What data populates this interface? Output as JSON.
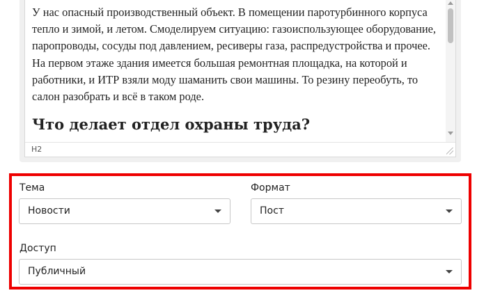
{
  "editor": {
    "paragraph": "У нас опасный производственный объект. В помещении паротурбинного корпуса тепло и зимой, и летом. Смоделируем ситуацию: газоиспользующее оборудование, паропроводы, сосуды под давлением, ресиверы газа, распредустройства и прочее. На первом этаже здания имеется большая ремонтная площадка, на которой и работники, и ИТР взяли моду шаманить свои машины. То резину переобуть, то салон разобрать и всё в таком роде.",
    "heading": "Что делает отдел охраны труда?",
    "status_path": "H2"
  },
  "fields": {
    "topic": {
      "label": "Тема",
      "value": "Новости"
    },
    "format": {
      "label": "Формат",
      "value": "Пост"
    },
    "access": {
      "label": "Доступ",
      "value": "Публичный"
    }
  },
  "colors": {
    "highlight_border": "#ee0000"
  }
}
